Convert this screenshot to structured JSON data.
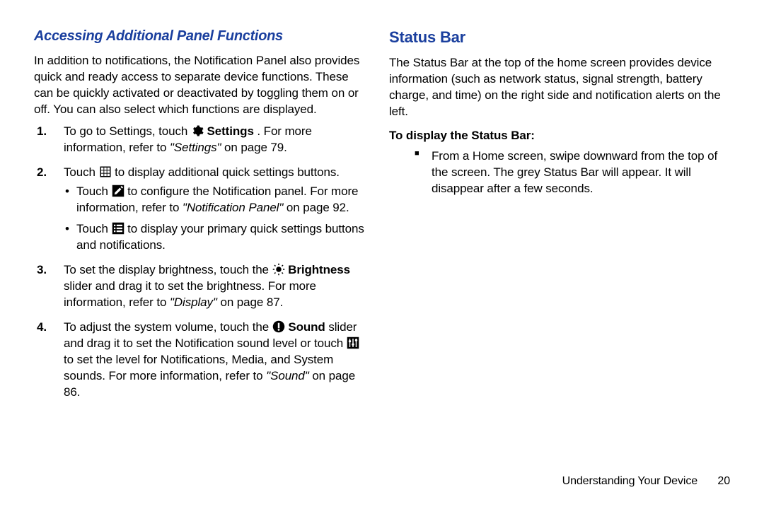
{
  "left": {
    "heading": "Accessing Additional Panel Functions",
    "intro": "In addition to notifications, the Notification Panel also provides quick and ready access to separate device functions. These can be quickly activated or deactivated by toggling them on or off. You can also select which functions are displayed.",
    "item1": {
      "pre": "To go to Settings, touch ",
      "label": "Settings",
      "post1": ". For more information, refer to ",
      "ref": "\"Settings\"",
      "post2": " on page 79."
    },
    "item2": {
      "pre": "Touch ",
      "post": " to display additional quick settings buttons.",
      "bullet1": {
        "pre": "Touch ",
        "post1": " to configure the Notification panel. For more information, refer to ",
        "ref": "\"Notification Panel\"",
        "post2": " on page 92."
      },
      "bullet2": {
        "pre": "Touch ",
        "post": " to display your primary quick settings buttons and notifications."
      }
    },
    "item3": {
      "pre": "To set the display brightness, touch the ",
      "label": "Brightness",
      "post1": " slider and drag it to set the brightness. For more information, refer to ",
      "ref": "\"Display\"",
      "post2": " on page 87."
    },
    "item4": {
      "pre": "To adjust the system volume, touch the ",
      "label": "Sound",
      "mid": " slider and drag it to set the Notification sound level or touch ",
      "post1": " to set the level for Notifications, Media, and System sounds. For more information, refer to ",
      "ref": "\"Sound\"",
      "post2": " on page 86."
    }
  },
  "right": {
    "heading": "Status Bar",
    "intro": "The Status Bar at the top of the home screen provides device information (such as network status, signal strength, battery charge, and time) on the right side and notification alerts on the left.",
    "subhead": "To display the Status Bar:",
    "bullet": "From a Home screen, swipe downward from the top of the screen. The grey Status Bar will appear. It will disappear after a few seconds."
  },
  "footer": {
    "section": "Understanding Your Device",
    "page": "20"
  }
}
